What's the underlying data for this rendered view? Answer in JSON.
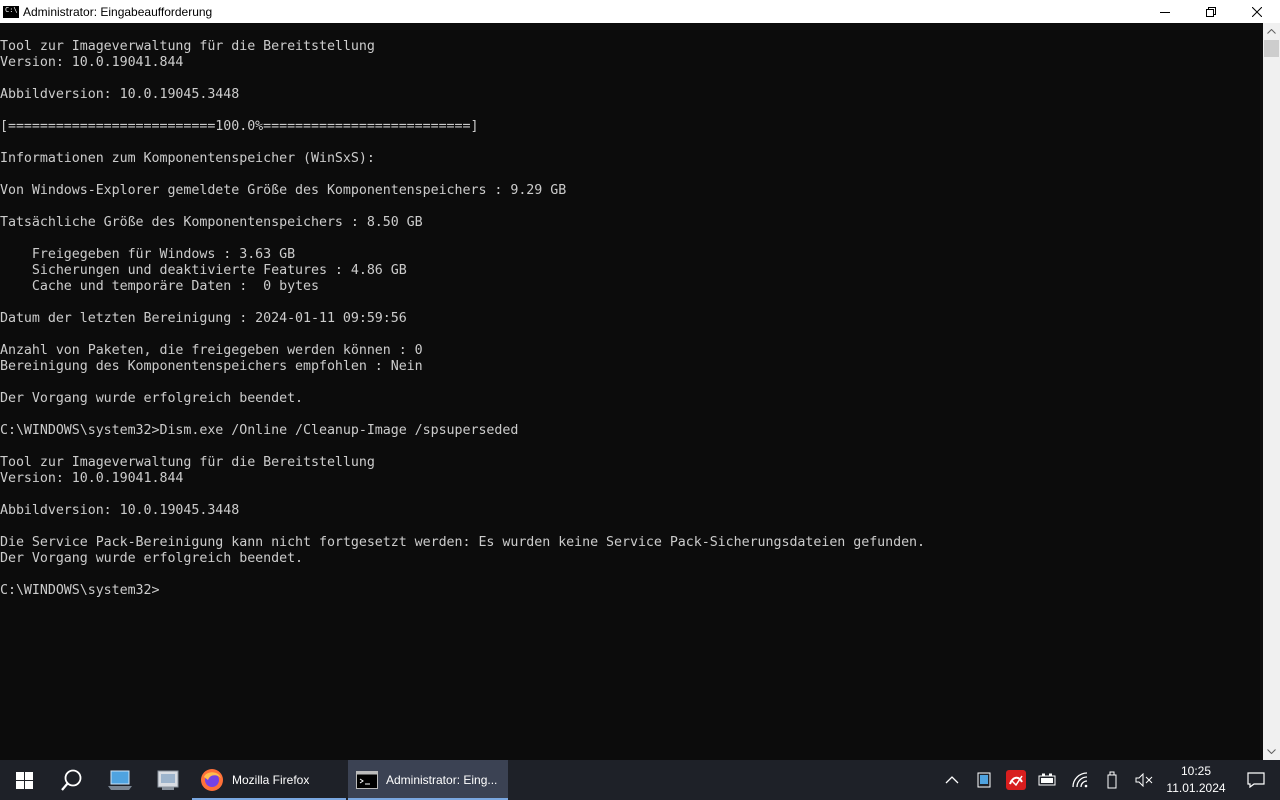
{
  "window": {
    "title": "Administrator: Eingabeaufforderung",
    "minimize_label": "minimize",
    "restore_label": "restore",
    "close_label": "close"
  },
  "console": {
    "lines": [
      "Tool zur Imageverwaltung für die Bereitstellung",
      "Version: 10.0.19041.844",
      "",
      "Abbildversion: 10.0.19045.3448",
      "",
      "[==========================100.0%==========================]",
      "",
      "Informationen zum Komponentenspeicher (WinSxS):",
      "",
      "Von Windows-Explorer gemeldete Größe des Komponentenspeichers : 9.29 GB",
      "",
      "Tatsächliche Größe des Komponentenspeichers : 8.50 GB",
      "",
      "    Freigegeben für Windows : 3.63 GB",
      "    Sicherungen und deaktivierte Features : 4.86 GB",
      "    Cache und temporäre Daten :  0 bytes",
      "",
      "Datum der letzten Bereinigung : 2024-01-11 09:59:56",
      "",
      "Anzahl von Paketen, die freigegeben werden können : 0",
      "Bereinigung des Komponentenspeichers empfohlen : Nein",
      "",
      "Der Vorgang wurde erfolgreich beendet.",
      "",
      "C:\\WINDOWS\\system32>Dism.exe /Online /Cleanup-Image /spsuperseded",
      "",
      "Tool zur Imageverwaltung für die Bereitstellung",
      "Version: 10.0.19041.844",
      "",
      "Abbildversion: 10.0.19045.3448",
      "",
      "Die Service Pack-Bereinigung kann nicht fortgesetzt werden: Es wurden keine Service Pack-Sicherungsdateien gefunden.",
      "Der Vorgang wurde erfolgreich beendet.",
      "",
      "C:\\WINDOWS\\system32>"
    ]
  },
  "taskbar": {
    "tasks": [
      {
        "label": "Mozilla Firefox",
        "icon": "firefox-icon"
      },
      {
        "label": "Administrator: Eing...",
        "icon": "cmd-icon"
      }
    ],
    "clock": {
      "time": "10:25",
      "date": "11.01.2024"
    }
  },
  "colors": {
    "console_bg": "#0c0c0c",
    "console_text": "#cccccc",
    "taskbar_bg": "#1e2128",
    "active_task_bg": "#3b4253"
  }
}
